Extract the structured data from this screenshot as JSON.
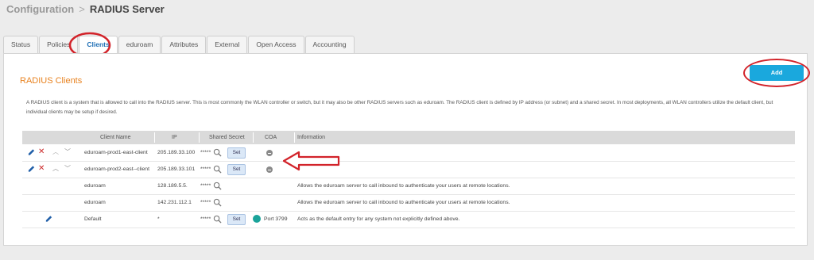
{
  "breadcrumb": {
    "parent": "Configuration",
    "separator": ">",
    "current": "RADIUS Server"
  },
  "tabs": [
    {
      "label": "Status",
      "active": false
    },
    {
      "label": "Policies",
      "active": false
    },
    {
      "label": "Clients",
      "active": true
    },
    {
      "label": "eduroam",
      "active": false
    },
    {
      "label": "Attributes",
      "active": false
    },
    {
      "label": "External",
      "active": false
    },
    {
      "label": "Open Access",
      "active": false
    },
    {
      "label": "Accounting",
      "active": false
    }
  ],
  "section": {
    "title": "RADIUS Clients",
    "add_label": "Add",
    "description": "A RADIUS client is a system that is allowed to call into the RADIUS server. This is most commonly the WLAN controller or switch, but it may also be other RADIUS servers such as eduroam. The RADIUS client is defined by IP address (or subnet) and a shared secret. In most deployments, all WLAN controllers utilize the default client, but individual clients may be setup if desired."
  },
  "table": {
    "headers": [
      "Client Name",
      "IP",
      "Shared Secret",
      "COA",
      "Information"
    ],
    "set_label": "Set",
    "rows": [
      {
        "name": "eduroam-prod1-east-client",
        "ip": "205.189.33.100",
        "secret": "*****",
        "set": true,
        "coa": "",
        "info": ""
      },
      {
        "name": "eduroam-prod2-east--client",
        "ip": "205.189.33.101",
        "secret": "*****",
        "set": true,
        "coa": "",
        "info": ""
      },
      {
        "name": "eduroam",
        "ip": "128.189.5.5.",
        "secret": "*****",
        "set": false,
        "coa": "",
        "info": "Allows the eduroam server to call inbound to authenticate your users at remote locations."
      },
      {
        "name": "eduroam",
        "ip": "142.231.112.1",
        "secret": "*****",
        "set": false,
        "coa": "",
        "info": "Allows the eduroam server to call inbound to authenticate your users at remote locations."
      },
      {
        "name": "Default",
        "ip": "*",
        "secret": "*****",
        "set": true,
        "coa": "Port 3799",
        "info": "Acts as the default entry for any system not explicitly defined above."
      }
    ]
  },
  "colors": {
    "accent": "#1aa8dd",
    "title": "#e8821f",
    "annotation": "#d2232a",
    "coa_on": "#1aa39a"
  },
  "icons": {
    "edit": "pencil-icon",
    "delete": "close-icon",
    "up": "chevron-up-icon",
    "down": "chevron-down-icon",
    "reveal": "search-icon"
  }
}
